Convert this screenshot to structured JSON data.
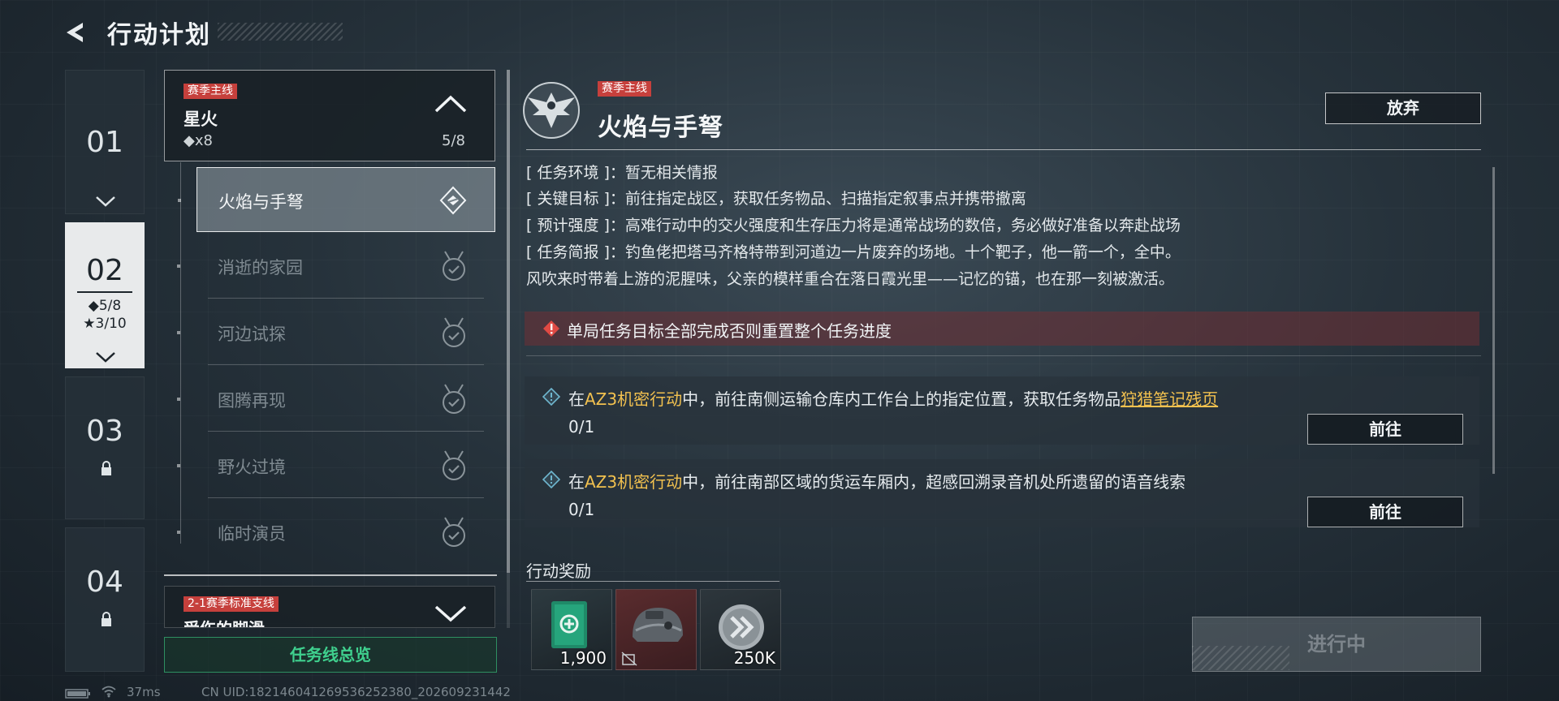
{
  "header": {
    "title": "行动计划"
  },
  "tabs": [
    {
      "number": "01",
      "state": "normal"
    },
    {
      "number": "02",
      "state": "active",
      "stat_diamond": "◆5/8",
      "stat_star": "★3/10"
    },
    {
      "number": "03",
      "state": "locked"
    },
    {
      "number": "04",
      "state": "locked"
    }
  ],
  "main_quest": {
    "tag": "赛季主线",
    "name": "星火",
    "reward": "◆x8",
    "progress": "5/8"
  },
  "sub_missions": [
    {
      "label": "火焰与手弩",
      "state": "active"
    },
    {
      "label": "消逝的家园",
      "state": "completed"
    },
    {
      "label": "河边试探",
      "state": "completed"
    },
    {
      "label": "图腾再现",
      "state": "completed"
    },
    {
      "label": "野火过境",
      "state": "completed"
    },
    {
      "label": "临时演员",
      "state": "completed"
    }
  ],
  "branch_quest": {
    "tag": "2-1赛季标准支线",
    "name": "受伤的脚滑"
  },
  "overview_button": "任务线总览",
  "detail": {
    "tag": "赛季主线",
    "title": "火焰与手弩",
    "abandon_label": "放弃",
    "info": [
      {
        "key": "[ 任务环境 ]：",
        "value": "暂无相关情报"
      },
      {
        "key": "[ 关键目标 ]：",
        "value": "前往指定战区，获取任务物品、扫描指定叙事点并携带撤离"
      },
      {
        "key": "[ 预计强度 ]：",
        "value": "高难行动中的交火强度和生存压力将是通常战场的数倍，务必做好准备以奔赴战场"
      },
      {
        "key": "[ 任务简报 ]：",
        "value": "钓鱼佬把塔马齐格特带到河道边一片废弃的场地。十个靶子，他一箭一个，全中。"
      }
    ],
    "brief_continued": "风吹来时带着上游的泥腥味，父亲的模样重合在落日霞光里——记忆的锚，也在那一刻被激活。",
    "warning": "单局任务目标全部完成否则重置整个任务进度",
    "objectives": [
      {
        "prefix": "在",
        "operation": "AZ3机密行动",
        "middle": "中，前往南侧运输仓库内工作台上的指定位置，获取任务物品",
        "item": "狩猎笔记残页",
        "progress": "0/1",
        "go_label": "前往"
      },
      {
        "prefix": "在",
        "operation": "AZ3机密行动",
        "middle": "中，前往南部区域的货运车厢内，超感回溯录音机处所遗留的语音线索",
        "item": "",
        "progress": "0/1",
        "go_label": "前往"
      }
    ],
    "rewards_title": "行动奖励",
    "rewards": [
      {
        "icon": "supply-card-icon",
        "qty": "1,900"
      },
      {
        "icon": "tactical-helmet-icon",
        "qty": ""
      },
      {
        "icon": "silver-coin-icon",
        "qty": "250K"
      }
    ],
    "status_button": "进行中"
  },
  "status_bar": {
    "ping": "37ms",
    "uid": "CN UID:182146041269536252380_202609231442"
  },
  "colors": {
    "tag_red": "#c6403c",
    "highlight_gold": "#f2c14f",
    "overview_green": "#3fd08e",
    "warning_bg": "#703034"
  }
}
